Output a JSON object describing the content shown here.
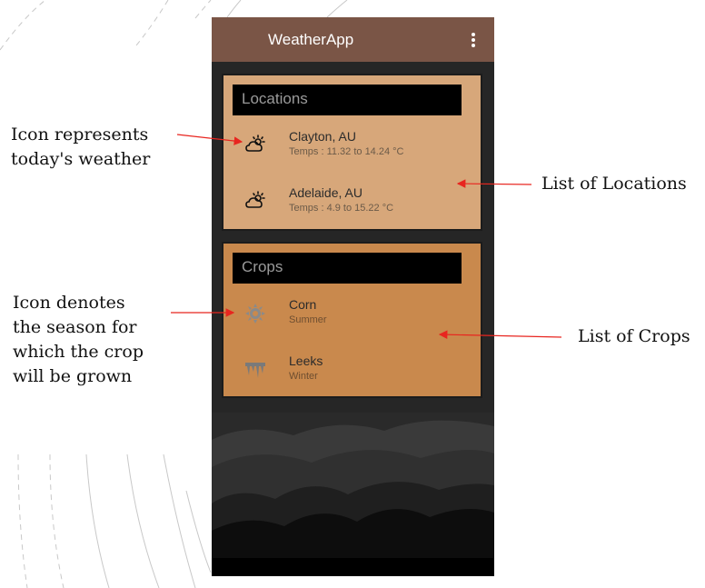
{
  "app": {
    "title": "WeatherApp",
    "menu_icon": "more-vert-icon"
  },
  "locations": {
    "header": "Locations",
    "items": [
      {
        "name": "Clayton, AU",
        "temps": "Temps : 11.32 to 14.24 °C",
        "icon": "partly-cloudy-icon"
      },
      {
        "name": "Adelaide, AU",
        "temps": "Temps : 4.9 to 15.22 °C",
        "icon": "partly-cloudy-icon"
      }
    ]
  },
  "crops": {
    "header": "Crops",
    "items": [
      {
        "name": "Corn",
        "season": "Summer",
        "icon": "sun-icon"
      },
      {
        "name": "Leeks",
        "season": "Winter",
        "icon": "icicles-icon"
      }
    ]
  },
  "annotations": {
    "weather_icon_line1": "Icon represents",
    "weather_icon_line2": "today's weather",
    "locations_list": "List of Locations",
    "season_icon_line1": "Icon denotes",
    "season_icon_line2": "the season for",
    "season_icon_line3": "which the crop",
    "season_icon_line4": "will be grown",
    "crops_list": "List of Crops"
  },
  "colors": {
    "appbar": "#7a5546",
    "locations_card": "#d7a77a",
    "crops_card": "#c9894d",
    "background": "#262626",
    "arrow": "#e8251f"
  }
}
